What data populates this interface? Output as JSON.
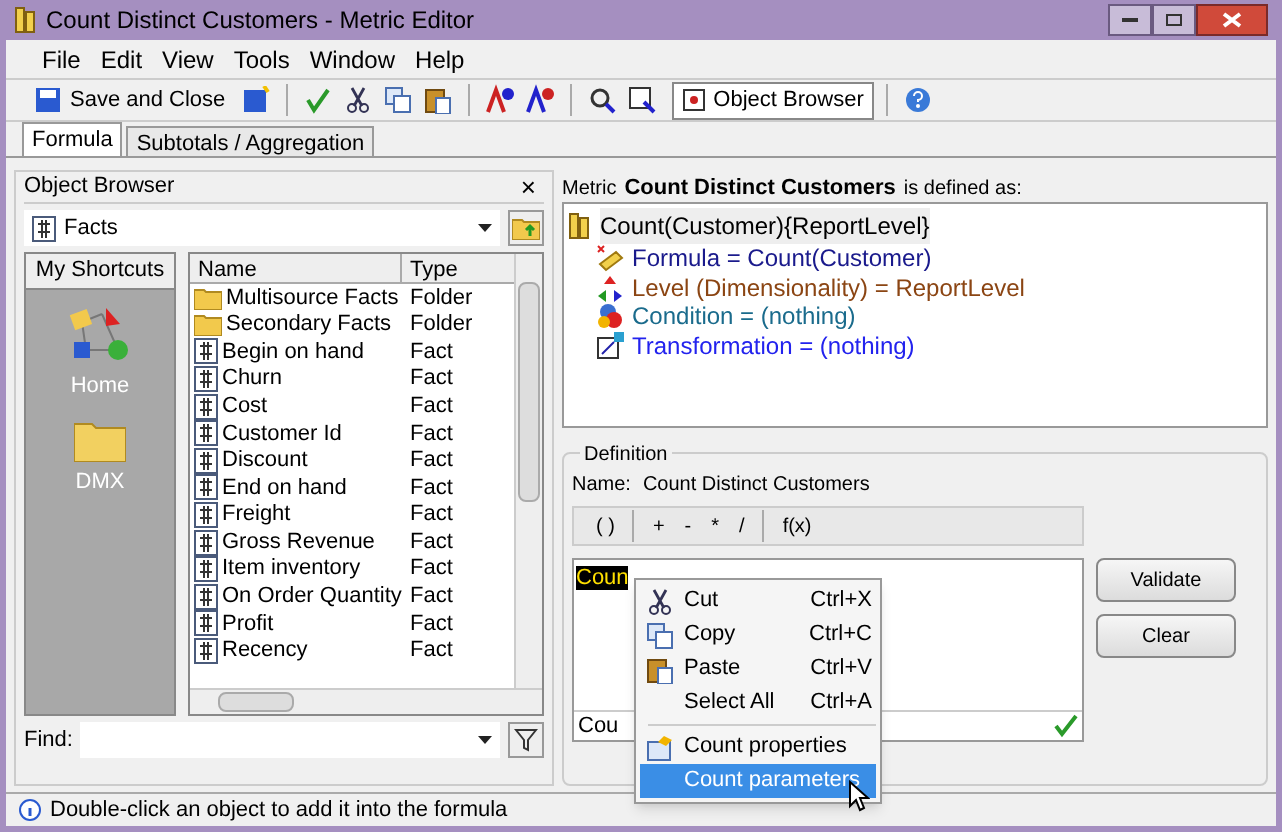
{
  "window": {
    "title": "Count Distinct Customers - Metric Editor"
  },
  "menu": [
    "File",
    "Edit",
    "View",
    "Tools",
    "Window",
    "Help"
  ],
  "toolbar": {
    "save_label": "Save and Close",
    "object_browser_label": "Object Browser",
    "object_browser_on": true
  },
  "tabs": [
    {
      "label": "Formula",
      "selected": true
    },
    {
      "label": "Subtotals / Aggregation",
      "selected": false
    }
  ],
  "object_browser": {
    "title": "Object Browser",
    "close": "×",
    "folder": "Facts",
    "shortcuts_title": "My Shortcuts",
    "shortcuts": [
      {
        "label": "Home",
        "kind": "home"
      },
      {
        "label": "DMX",
        "kind": "folder"
      }
    ],
    "columns": [
      "Name",
      "Type"
    ],
    "rows": [
      {
        "name": "Multisource Facts",
        "type": "Folder",
        "kind": "folder"
      },
      {
        "name": "Secondary Facts",
        "type": "Folder",
        "kind": "folder"
      },
      {
        "name": "Begin on hand",
        "type": "Fact",
        "kind": "fact"
      },
      {
        "name": "Churn",
        "type": "Fact",
        "kind": "fact"
      },
      {
        "name": "Cost",
        "type": "Fact",
        "kind": "fact"
      },
      {
        "name": "Customer Id",
        "type": "Fact",
        "kind": "fact"
      },
      {
        "name": "Discount",
        "type": "Fact",
        "kind": "fact"
      },
      {
        "name": "End on hand",
        "type": "Fact",
        "kind": "fact"
      },
      {
        "name": "Freight",
        "type": "Fact",
        "kind": "fact"
      },
      {
        "name": "Gross Revenue",
        "type": "Fact",
        "kind": "fact"
      },
      {
        "name": "Item inventory",
        "type": "Fact",
        "kind": "fact"
      },
      {
        "name": "On Order Quantity",
        "type": "Fact",
        "kind": "fact"
      },
      {
        "name": "Profit",
        "type": "Fact",
        "kind": "fact"
      },
      {
        "name": "Recency",
        "type": "Fact",
        "kind": "fact"
      }
    ],
    "find_label": "Find:"
  },
  "metric": {
    "prefix": "Metric",
    "name": "Count Distinct Customers",
    "suffix": "is defined as:",
    "root": "Count(Customer){ReportLevel}",
    "children": [
      {
        "label": "Formula = Count(Customer)",
        "kind": "formula",
        "color": "#1a1a8c"
      },
      {
        "label": "Level (Dimensionality) = ReportLevel",
        "kind": "level",
        "color": "#8b4513"
      },
      {
        "label": "Condition = (nothing)",
        "kind": "condition",
        "color": "#1a6b8c"
      },
      {
        "label": "Transformation = (nothing)",
        "kind": "transformation",
        "color": "#2222ee"
      }
    ]
  },
  "definition": {
    "title": "Definition",
    "name_label": "Name:",
    "name": "Count Distinct Customers",
    "operators": [
      {
        "label": "( )",
        "separator_before": false
      },
      {
        "label": "+",
        "separator_before": true
      },
      {
        "label": "-",
        "separator_before": false
      },
      {
        "label": "*",
        "separator_before": false
      },
      {
        "label": "/",
        "separator_before": false
      },
      {
        "label": "f(x)",
        "separator_before": true
      }
    ],
    "formula_selected": "Coun",
    "formula_status": "Cou",
    "valid": true,
    "buttons": [
      "Validate",
      "Clear"
    ]
  },
  "context_menu": [
    {
      "label": "Cut",
      "shortcut": "Ctrl+X",
      "kind": "cut",
      "selected": false
    },
    {
      "label": "Copy",
      "shortcut": "Ctrl+C",
      "kind": "copy",
      "selected": false
    },
    {
      "label": "Paste",
      "shortcut": "Ctrl+V",
      "kind": "paste",
      "selected": false
    },
    {
      "label": "Select All",
      "shortcut": "Ctrl+A",
      "kind": "plain",
      "selected": false
    },
    {
      "label": "Count properties",
      "kind": "properties",
      "selected": false,
      "separator": true
    },
    {
      "label": "Count parameters",
      "kind": "plain",
      "selected": true
    }
  ],
  "status_bar": "Double-click an object to add it into the formula"
}
